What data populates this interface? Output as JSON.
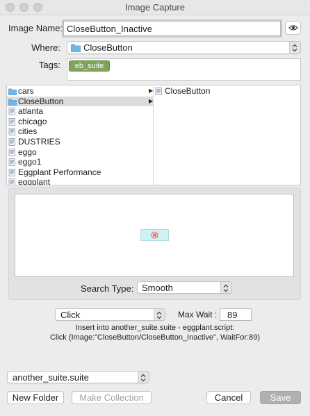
{
  "window": {
    "title": "Image Capture"
  },
  "form": {
    "image_name_label": "Image Name:",
    "image_name_value": "CloseButton_Inactive",
    "where_label": "Where:",
    "where_value": "CloseButton",
    "where_icon": "folder-icon",
    "tags_label": "Tags:",
    "tags": [
      "eb_suite"
    ]
  },
  "browser": {
    "left_items": [
      {
        "label": "cars",
        "icon": "folder-icon",
        "has_children": true,
        "selected": false
      },
      {
        "label": "CloseButton",
        "icon": "folder-icon",
        "has_children": true,
        "selected": true
      },
      {
        "label": "atlanta",
        "icon": "document-icon",
        "has_children": false,
        "selected": false
      },
      {
        "label": "chicago",
        "icon": "document-icon",
        "has_children": false,
        "selected": false
      },
      {
        "label": "cities",
        "icon": "document-icon",
        "has_children": false,
        "selected": false
      },
      {
        "label": "DUSTRIES",
        "icon": "document-icon",
        "has_children": false,
        "selected": false
      },
      {
        "label": "eggo",
        "icon": "document-icon",
        "has_children": false,
        "selected": false
      },
      {
        "label": "eggo1",
        "icon": "document-icon",
        "has_children": false,
        "selected": false
      },
      {
        "label": "Eggplant Performance",
        "icon": "document-icon",
        "has_children": false,
        "selected": false
      },
      {
        "label": "eggplant",
        "icon": "document-icon",
        "has_children": false,
        "selected": false
      }
    ],
    "right_items": [
      {
        "label": "CloseButton",
        "icon": "document-icon",
        "has_children": false,
        "selected": false
      }
    ]
  },
  "preview": {
    "search_type_label": "Search Type:",
    "search_type_value": "Smooth"
  },
  "action": {
    "command": "Click",
    "max_wait_label": "Max Wait :",
    "max_wait_value": "89",
    "insert_line": "Insert into another_suite.suite - eggplant.script:",
    "code_line": "Click (Image:\"CloseButton/CloseButton_Inactive\", WaitFor:89)"
  },
  "footer": {
    "suite": "another_suite.suite",
    "new_folder": "New Folder",
    "make_collection": "Make Collection",
    "cancel": "Cancel",
    "save": "Save"
  },
  "colors": {
    "window_bg": "#ececec",
    "tag_green": "#7ea35a",
    "selection_gray": "#dcdcdc",
    "folder_blue": "#6cb6ea",
    "preview_image_bg": "#cff1f3",
    "preview_image_mark": "#d9443b"
  }
}
